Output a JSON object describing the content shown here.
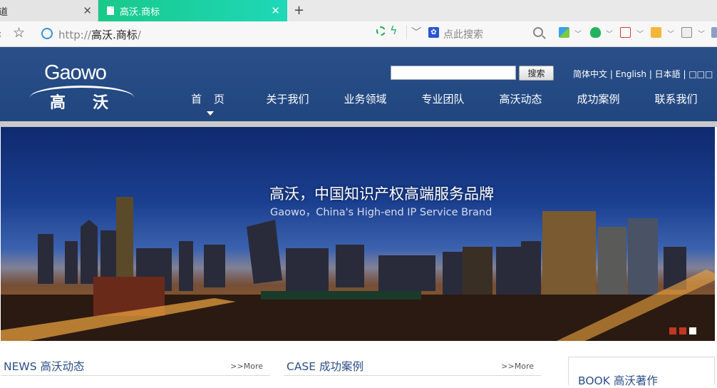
{
  "browser": {
    "tabs": [
      {
        "label": "道",
        "active": false
      },
      {
        "label": "高沃.商标",
        "active": true
      }
    ],
    "new_tab_label": "+",
    "close_label": "✕",
    "address": {
      "prefix": "http://",
      "host": "高沃.商标",
      "suffix": "/"
    },
    "search_placeholder": "点此搜索"
  },
  "header": {
    "logo_en": "Gaowo",
    "logo_cn": "高沃",
    "search_button": "搜索",
    "search_value": "",
    "languages": "简体中文 | English | 日本語 | □□□",
    "nav": [
      "首 页",
      "关于我们",
      "业务领域",
      "专业团队",
      "高沃动态",
      "成功案例",
      "联系我们"
    ]
  },
  "banner": {
    "title": "高沃，中国知识产权高端服务品牌",
    "subtitle": "Gaowo，China's High-end IP Service Brand",
    "slides": 3,
    "active_slide": 3
  },
  "sections": {
    "news": {
      "title": "NEWS 高沃动态",
      "more": ">>More"
    },
    "case": {
      "title": "CASE 成功案例",
      "more": ">>More"
    },
    "book": {
      "title": "BOOK 高沃著作"
    }
  },
  "colors": {
    "header_bg": "#2b4f89",
    "tab_active": "#19c98a",
    "section_title": "#2b4f89",
    "slide_dot_inactive": "#c0391f",
    "slide_dot_active": "#ffffff"
  }
}
